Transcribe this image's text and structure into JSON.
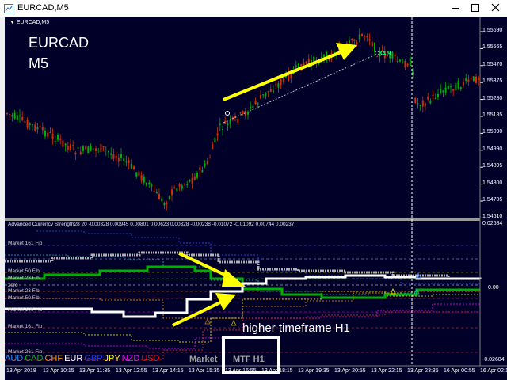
{
  "window": {
    "title": "EURCAD,M5",
    "tab_label": "EURCAD,M5",
    "symbol_line1": "EURCAD",
    "symbol_line2": "M5"
  },
  "price_axis": [
    "1.55690",
    "1.55565",
    "1.55470",
    "1.55375",
    "1.55280",
    "1.55185",
    "1.55090",
    "1.54990",
    "1.54895",
    "1.54800",
    "1.54705",
    "1.54610"
  ],
  "indicator": {
    "header": "Advanced Currency Strength28 20 -0.00328 0.00945 0.00801 0.00623 0.00328 -0.00238 -0.01072 -0.01092 0.00744 0.00237",
    "axis_top": "0.02684",
    "axis_zero": "0.00",
    "axis_bottom": "-0.02684",
    "fib_labels": {
      "m161_top": "Market 161 Fib",
      "m50_top": "Market 50 Fib",
      "m23": "Market 23 Fib",
      "zero": "zero",
      "m23_low": "Market 23 Fib",
      "m50_low": "Market 50 Fib",
      "m100_low": "Market 100 Fib",
      "m161_low": "Market 161 Fib",
      "m261_low": "Market 261 Fib"
    },
    "currencies": [
      {
        "name": "AUD",
        "color": "#1e90ff"
      },
      {
        "name": "CAD",
        "color": "#00c000"
      },
      {
        "name": "CHF",
        "color": "#ff8c00"
      },
      {
        "name": "EUR",
        "color": "#ffffff"
      },
      {
        "name": "GBP",
        "color": "#1e3cff"
      },
      {
        "name": "JPY",
        "color": "#ffff00"
      },
      {
        "name": "NZD",
        "color": "#ff00ff"
      },
      {
        "name": "USD",
        "color": "#ff0000"
      }
    ],
    "market_label": "Market",
    "mtf_label": "MTF H1",
    "overlay_value": "34.9"
  },
  "annotation": {
    "higher_tf": "higher timeframe H1"
  },
  "time_axis": [
    "13 Apr 2018",
    "13 Apr 10:15",
    "13 Apr 11:35",
    "13 Apr 12:55",
    "13 Apr 14:15",
    "13 Apr 15:35",
    "13 Apr 16:55",
    "13 Apr 18:15",
    "13 Apr 19:35",
    "13 Apr 20:55",
    "13 Apr 22:15",
    "13 Apr 23:35",
    "16 Apr 00:55",
    "16 Apr 02:15"
  ],
  "colors": {
    "background": "#000028",
    "bull_candle": "#00b000",
    "bear_candle": "#d03000",
    "arrow": "#ffff00",
    "mtf_box": "#ffffff"
  }
}
